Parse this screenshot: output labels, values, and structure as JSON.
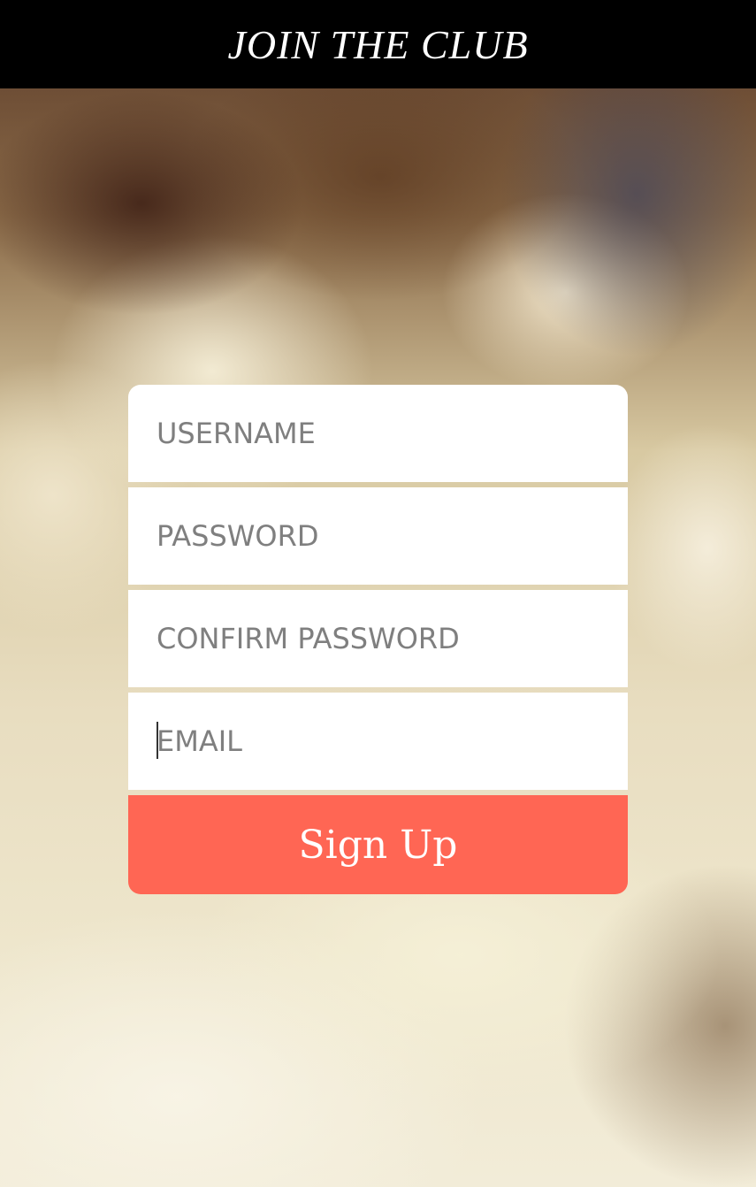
{
  "header": {
    "title": "JOIN THE CLUB"
  },
  "form": {
    "username": {
      "placeholder": "USERNAME",
      "value": ""
    },
    "password": {
      "placeholder": "PASSWORD",
      "value": ""
    },
    "confirm_password": {
      "placeholder": "CONFIRM PASSWORD",
      "value": ""
    },
    "email": {
      "placeholder": "EMAIL",
      "value": ""
    },
    "signup_label": "Sign Up"
  },
  "colors": {
    "header_bg": "#000000",
    "button_bg": "#ff6654",
    "placeholder": "#7f7f7f"
  }
}
